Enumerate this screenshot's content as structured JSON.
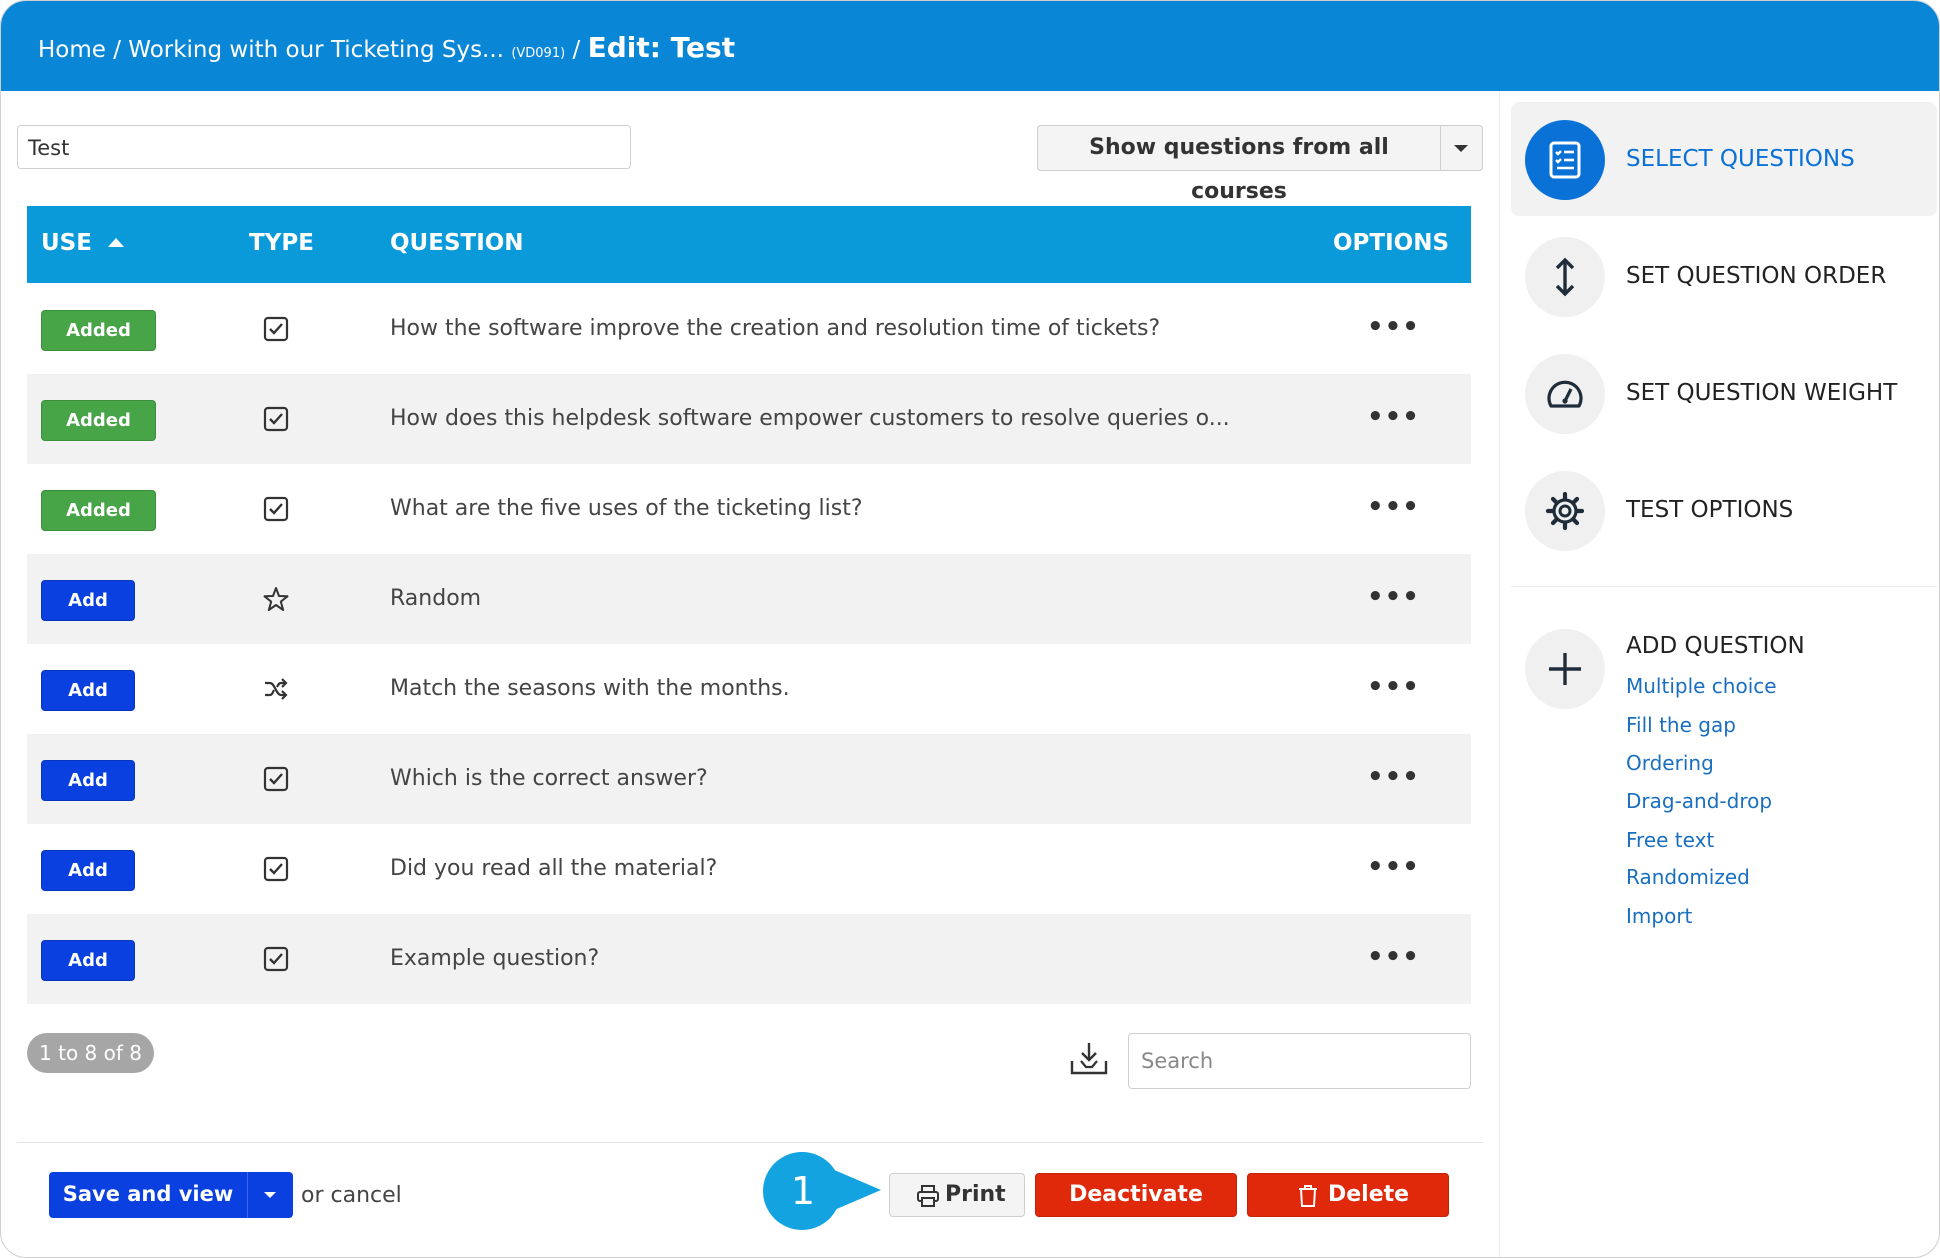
{
  "breadcrumb": {
    "home": "Home",
    "sep1": " / ",
    "course": "Working with our Ticketing Sys...",
    "course_code": "(VD091)",
    "sep2": " / ",
    "current": "Edit: Test"
  },
  "test_name": {
    "value": "Test"
  },
  "course_filter": {
    "label": "Show questions from all courses"
  },
  "table": {
    "headers": {
      "use": "USE",
      "type": "TYPE",
      "question": "QUESTION",
      "options": "OPTIONS"
    },
    "rows": [
      {
        "status": "Added",
        "type_icon": "checkbox-icon",
        "question": "How the software improve the creation and resolution time of tickets?",
        "options": "•••"
      },
      {
        "status": "Added",
        "type_icon": "checkbox-icon",
        "question": "How does this helpdesk software empower customers to resolve queries o...",
        "options": "•••"
      },
      {
        "status": "Added",
        "type_icon": "checkbox-icon",
        "question": "What are the five uses of the ticketing list?",
        "options": "•••"
      },
      {
        "status": "Add",
        "type_icon": "star-icon",
        "question": "Random",
        "options": "•••"
      },
      {
        "status": "Add",
        "type_icon": "shuffle-icon",
        "question": "Match the seasons with the months.",
        "options": "•••"
      },
      {
        "status": "Add",
        "type_icon": "checkbox-icon",
        "question": "Which is the correct answer?",
        "options": "•••"
      },
      {
        "status": "Add",
        "type_icon": "checkbox-icon",
        "question": "Did you read all the material?",
        "options": "•••"
      },
      {
        "status": "Add",
        "type_icon": "checkbox-icon",
        "question": "Example question?",
        "options": "•••"
      }
    ]
  },
  "pager": {
    "text": "1 to 8 of 8"
  },
  "search": {
    "placeholder": "Search"
  },
  "footer": {
    "save_label": "Save and view",
    "cancel_text": "or cancel",
    "callout_number": "1",
    "print_label": "Print",
    "deactivate_label": "Deactivate",
    "delete_label": "Delete"
  },
  "sidebar": {
    "items": [
      {
        "label": "SELECT QUESTIONS",
        "icon": "list-icon",
        "active": true
      },
      {
        "label": "SET QUESTION ORDER",
        "icon": "vertical-arrows-icon"
      },
      {
        "label": "SET QUESTION WEIGHT",
        "icon": "gauge-icon"
      },
      {
        "label": "TEST OPTIONS",
        "icon": "gear-icon"
      }
    ],
    "add_question": {
      "title": "ADD QUESTION",
      "links": [
        "Multiple choice",
        "Fill the gap",
        "Ordering",
        "Drag-and-drop",
        "Free text",
        "Randomized",
        "Import"
      ]
    }
  },
  "colors": {
    "topbar": "#0a86d6",
    "table_header": "#0a9ad9",
    "added_badge": "#47a447",
    "add_badge": "#0a3fe0",
    "danger": "#e0280a",
    "link": "#1a6fc0"
  }
}
